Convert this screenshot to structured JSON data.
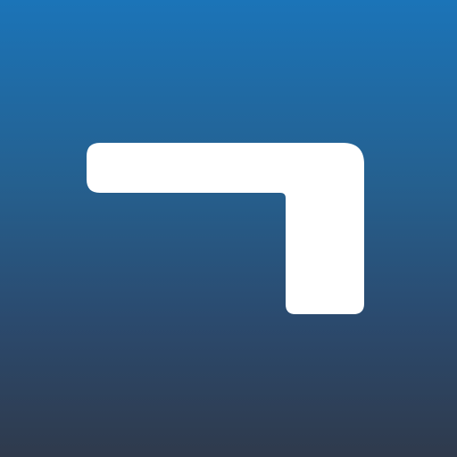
{
  "icon": {
    "name": "l-shaped-logo-mark",
    "background_gradient": [
      "#1b74b8",
      "#25608f",
      "#2b4a6e",
      "#2f3a4c"
    ],
    "mark_color": "#ffffff"
  }
}
